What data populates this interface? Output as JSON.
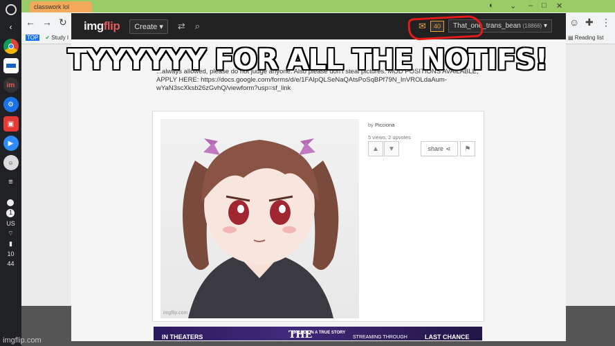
{
  "meme_caption": "TYYYYYY FOR ALL THE NOTIFS!",
  "watermark": "imgflip.com",
  "browser": {
    "tab_label": "classwork lol",
    "bookmark_study": "Study I",
    "reading_list": "Reading list"
  },
  "shelf": {
    "status_lang": "US",
    "status_time_hour": "10",
    "status_time_min": "44",
    "notif_count": "1"
  },
  "imgflip": {
    "logo_img": "img",
    "logo_flip": "flip",
    "create_label": "Create",
    "notification_count": "40",
    "username": "That_one_trans_bean",
    "user_points": "(18866)",
    "description": "...always allowed, please do not judge anyone. Also please don't steal pictures. MOD POSITIONS AVAILABLE, APPLY HERE: https://docs.google.com/forms/d/e/1FAIpQLSeNaQAtsPoSqBPf79N_InVROLdaAum-wYaN3scXksb26zGvhQ/viewform?usp=sf_link",
    "meta_by": "by",
    "meta_author": "Picciona",
    "meta_stats": "5 views, 2 upvotes",
    "share_label": "share",
    "image_watermark": "imgflip.com",
    "ad_left": "IN THEATERS",
    "ad_mid1": "THE",
    "ad_mid2": "BASED ON A TRUE STORY",
    "ad_mid3": "STREAMING THROUGH",
    "ad_right": "LAST CHANCE"
  },
  "colors": {
    "accent_orange": "#e8a33c",
    "annotation_red": "#e21b1b",
    "nav_bg": "#222222"
  }
}
